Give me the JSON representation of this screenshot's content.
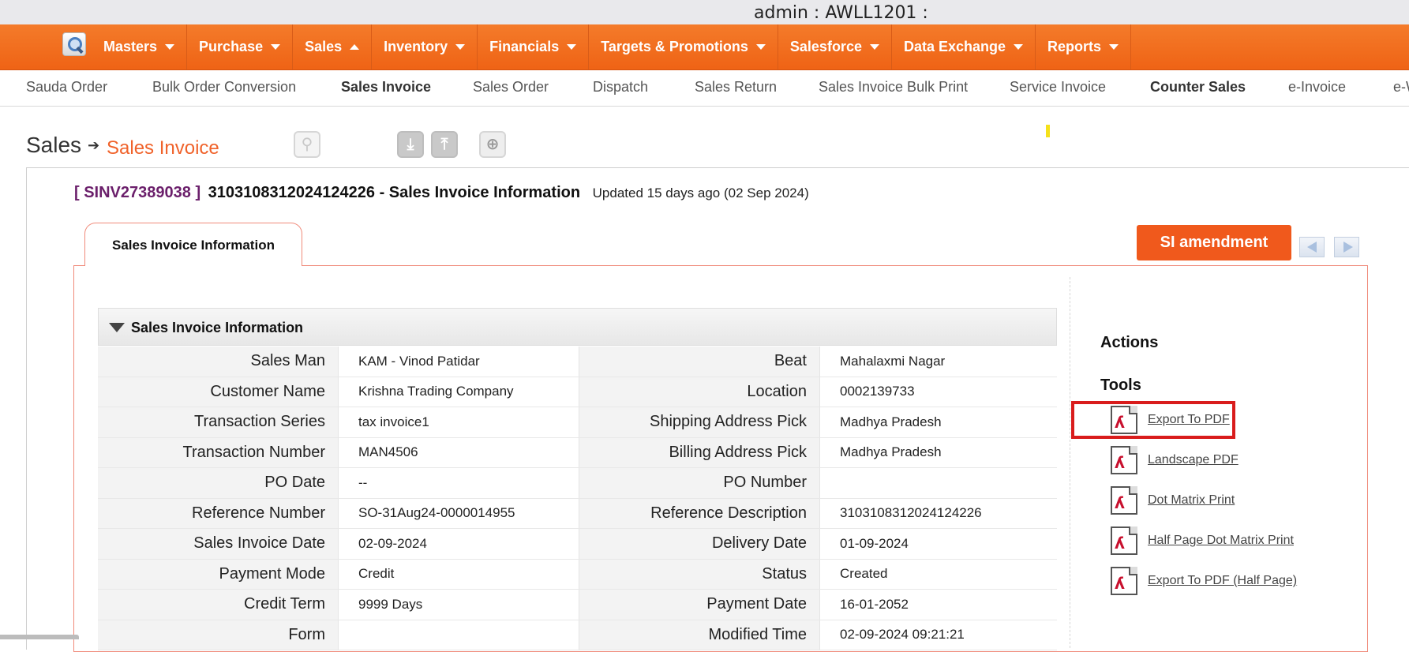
{
  "header": {
    "user_line": "admin : AWLL1201 :"
  },
  "main_menu": [
    {
      "label": "Masters",
      "caret": "down"
    },
    {
      "label": "Purchase",
      "caret": "down"
    },
    {
      "label": "Sales",
      "caret": "up"
    },
    {
      "label": "Inventory",
      "caret": "down"
    },
    {
      "label": "Financials",
      "caret": "down"
    },
    {
      "label": "Targets & Promotions",
      "caret": "down"
    },
    {
      "label": "Salesforce",
      "caret": "down"
    },
    {
      "label": "Data Exchange",
      "caret": "down"
    },
    {
      "label": "Reports",
      "caret": "down"
    }
  ],
  "sub_menu": [
    "Sauda Order",
    "Bulk Order Conversion",
    "Sales Invoice",
    "Sales Order",
    "Dispatch",
    "Sales Return",
    "Sales Invoice Bulk Print",
    "Service Invoice",
    "Counter Sales",
    "e-Invoice",
    "e-W"
  ],
  "breadcrumb": {
    "root": "Sales",
    "current": "Sales Invoice"
  },
  "toolbar_icons": [
    "search-icon",
    "download-icon",
    "upload-icon",
    "zoom-icon"
  ],
  "invoice": {
    "id": "[ SINV27389038 ]",
    "number": "3103108312024124226 - Sales Invoice Information",
    "updated": "Updated 15 days ago (02 Sep 2024)"
  },
  "tab": {
    "label": "Sales Invoice Information"
  },
  "si_amendment_label": "SI amendment",
  "section_title": "Sales Invoice Information",
  "rows": [
    {
      "l1": "Sales Man",
      "v1": "KAM - Vinod Patidar",
      "l2": "Beat",
      "v2": "Mahalaxmi Nagar"
    },
    {
      "l1": "Customer Name",
      "v1": "Krishna Trading Company",
      "l2": "Location",
      "v2": "0002139733"
    },
    {
      "l1": "Transaction Series",
      "v1": "tax invoice1",
      "l2": "Shipping Address Pick",
      "v2": "Madhya Pradesh"
    },
    {
      "l1": "Transaction Number",
      "v1": "MAN4506",
      "l2": "Billing Address Pick",
      "v2": "Madhya Pradesh"
    },
    {
      "l1": "PO Date",
      "v1": "--",
      "l2": "PO Number",
      "v2": ""
    },
    {
      "l1": "Reference Number",
      "v1": "SO-31Aug24-0000014955",
      "l2": "Reference Description",
      "v2": "3103108312024124226"
    },
    {
      "l1": "Sales Invoice Date",
      "v1": "02-09-2024",
      "l2": "Delivery Date",
      "v2": "01-09-2024"
    },
    {
      "l1": "Payment Mode",
      "v1": "Credit",
      "l2": "Status",
      "v2": "Created"
    },
    {
      "l1": "Credit Term",
      "v1": "9999 Days",
      "l2": "Payment Date",
      "v2": "16-01-2052"
    },
    {
      "l1": "Form",
      "v1": "",
      "l2": "Modified Time",
      "v2": "02-09-2024 09:21:21"
    }
  ],
  "side": {
    "actions_title": "Actions",
    "tools_title": "Tools",
    "tools": [
      "Export To PDF",
      "Landscape PDF",
      "Dot Matrix Print",
      "Half Page Dot Matrix Print",
      "Export To PDF (Half Page)"
    ]
  },
  "colors": {
    "menu_bar": "#ef6315",
    "accent": "#f0591c",
    "invoice_id": "#6b1f6b",
    "highlight": "#d91c1c"
  }
}
